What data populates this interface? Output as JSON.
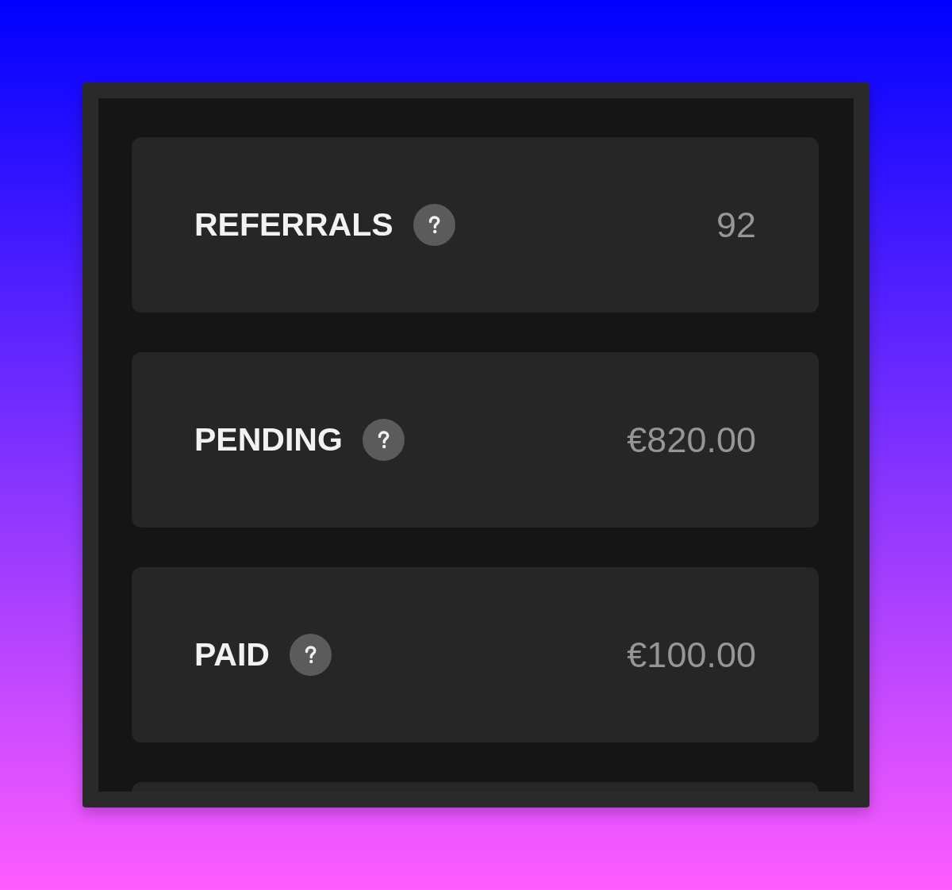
{
  "stats": [
    {
      "label": "REFERRALS",
      "value": "92"
    },
    {
      "label": "PENDING",
      "value": "€820.00"
    },
    {
      "label": "PAID",
      "value": "€100.00"
    }
  ],
  "more_below": true
}
